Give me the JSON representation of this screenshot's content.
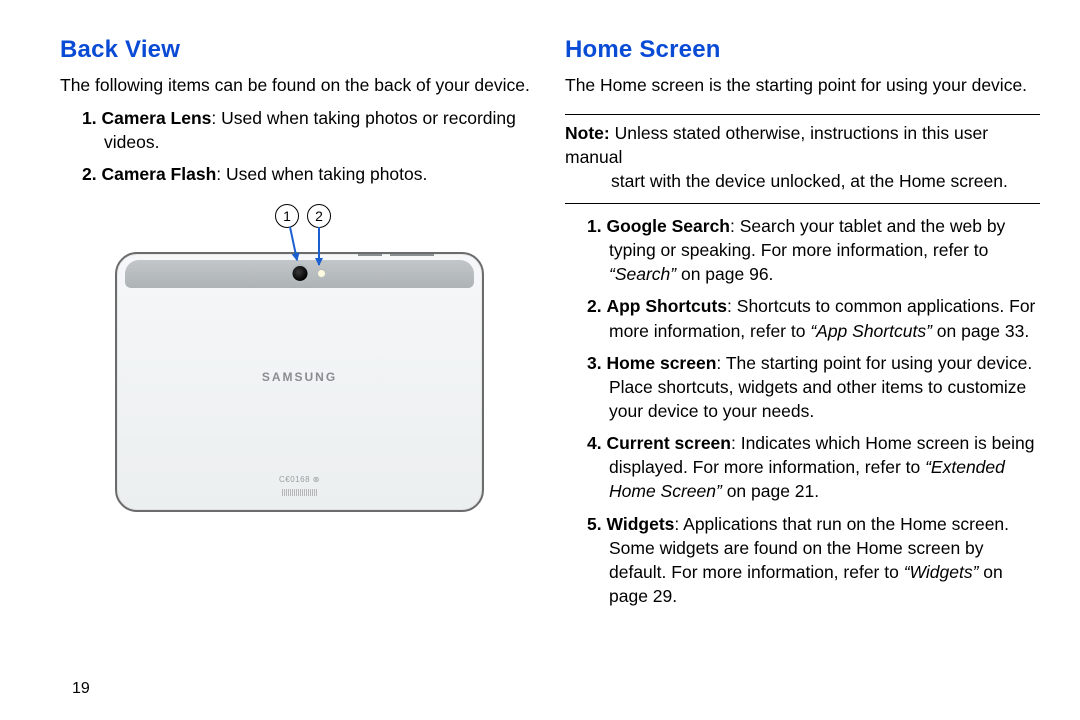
{
  "page_number": "19",
  "left": {
    "heading": "Back View",
    "intro": "The following items can be found on the back of your device.",
    "items": [
      {
        "n": "1.",
        "term": "Camera Lens",
        "desc": ": Used when taking photos or recording videos."
      },
      {
        "n": "2.",
        "term": "Camera Flash",
        "desc": ": Used when taking photos."
      }
    ],
    "figure": {
      "callout1": "1",
      "callout2": "2",
      "brand": "SAMSUNG",
      "cert": "C€0168 ⊗"
    }
  },
  "right": {
    "heading": "Home Screen",
    "intro": "The Home screen is the starting point for using your device.",
    "note_label": "Note:",
    "note_body_line1": " Unless stated otherwise, instructions in this user manual",
    "note_body_line2": "start with the device unlocked, at the Home screen.",
    "items": [
      {
        "n": "1.",
        "term": "Google Search",
        "desc1": ": Search your tablet and the web by typing or speaking. For more information, refer to ",
        "ref": "“Search”",
        "desc2": "  on page 96."
      },
      {
        "n": "2.",
        "term": "App Shortcuts",
        "desc1": ": Shortcuts to common applications. For more information, refer to ",
        "ref": "“App Shortcuts”",
        "desc2": "  on page 33."
      },
      {
        "n": "3.",
        "term": "Home screen",
        "desc1": ": The starting point for using your device. Place shortcuts, widgets and other items to customize your device to your needs.",
        "ref": "",
        "desc2": ""
      },
      {
        "n": "4.",
        "term": "Current screen",
        "desc1": ": Indicates which Home screen is being displayed. For more information, refer to ",
        "ref": "“Extended Home Screen”",
        "desc2": "  on page 21."
      },
      {
        "n": "5.",
        "term": "Widgets",
        "desc1": ": Applications that run on the Home screen. Some widgets are found on the Home screen by default. For more information, refer to ",
        "ref": "“Widgets”",
        "desc2": "  on page 29."
      }
    ]
  }
}
